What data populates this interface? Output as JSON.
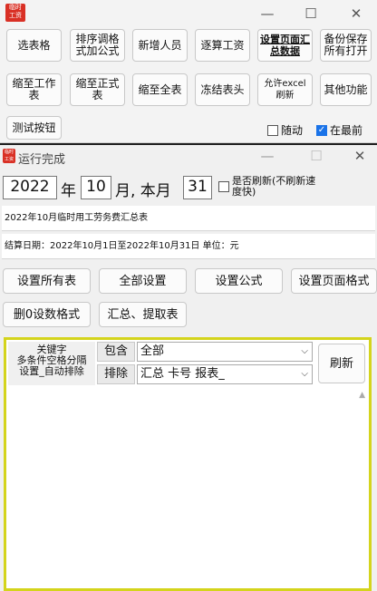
{
  "win1": {
    "icon_text": [
      "临时",
      "工资"
    ],
    "buttons_row1": [
      "选表格",
      "排序调格式加公式",
      "新增人员",
      "逐算工资",
      "设置页面汇总数据",
      "备份保存所有打开"
    ],
    "buttons_row2": [
      "缩至工作表",
      "缩至正式表",
      "缩至全表",
      "冻结表头",
      "允许excel刷新",
      "其他功能"
    ],
    "test_button": "测试按钮",
    "chk_follow": "随动",
    "chk_top": "在最前"
  },
  "win2": {
    "title": "运行完成",
    "year": "2022",
    "year_unit": "年",
    "month": "10",
    "month_text": "月, 本月",
    "days": "31",
    "refresh_label": "是否刷新(不刷新速度快)",
    "table_title": "2022年10月临时用工劳务费汇总表",
    "settle_text": "结算日期：2022年10月1日至2022年10月31日  单位：元",
    "btn_all_tables": "设置所有表",
    "btn_all_settings": "全部设置",
    "btn_formula": "设置公式",
    "btn_page_format": "设置页面格式",
    "btn_del_zero": "删0设数格式",
    "btn_summary": "汇总、提取表",
    "keyword_label": "关键字\n多条件空格分隔\n设置_自动排除",
    "include_label": "包含",
    "include_value": "全部",
    "exclude_label": "排除",
    "exclude_value": "汇总 卡号 报表_",
    "refresh_btn": "刷新"
  },
  "colors": {
    "accent": "#1a73e8",
    "panel_border": "#d4d41c",
    "icon_red": "#d93025"
  }
}
